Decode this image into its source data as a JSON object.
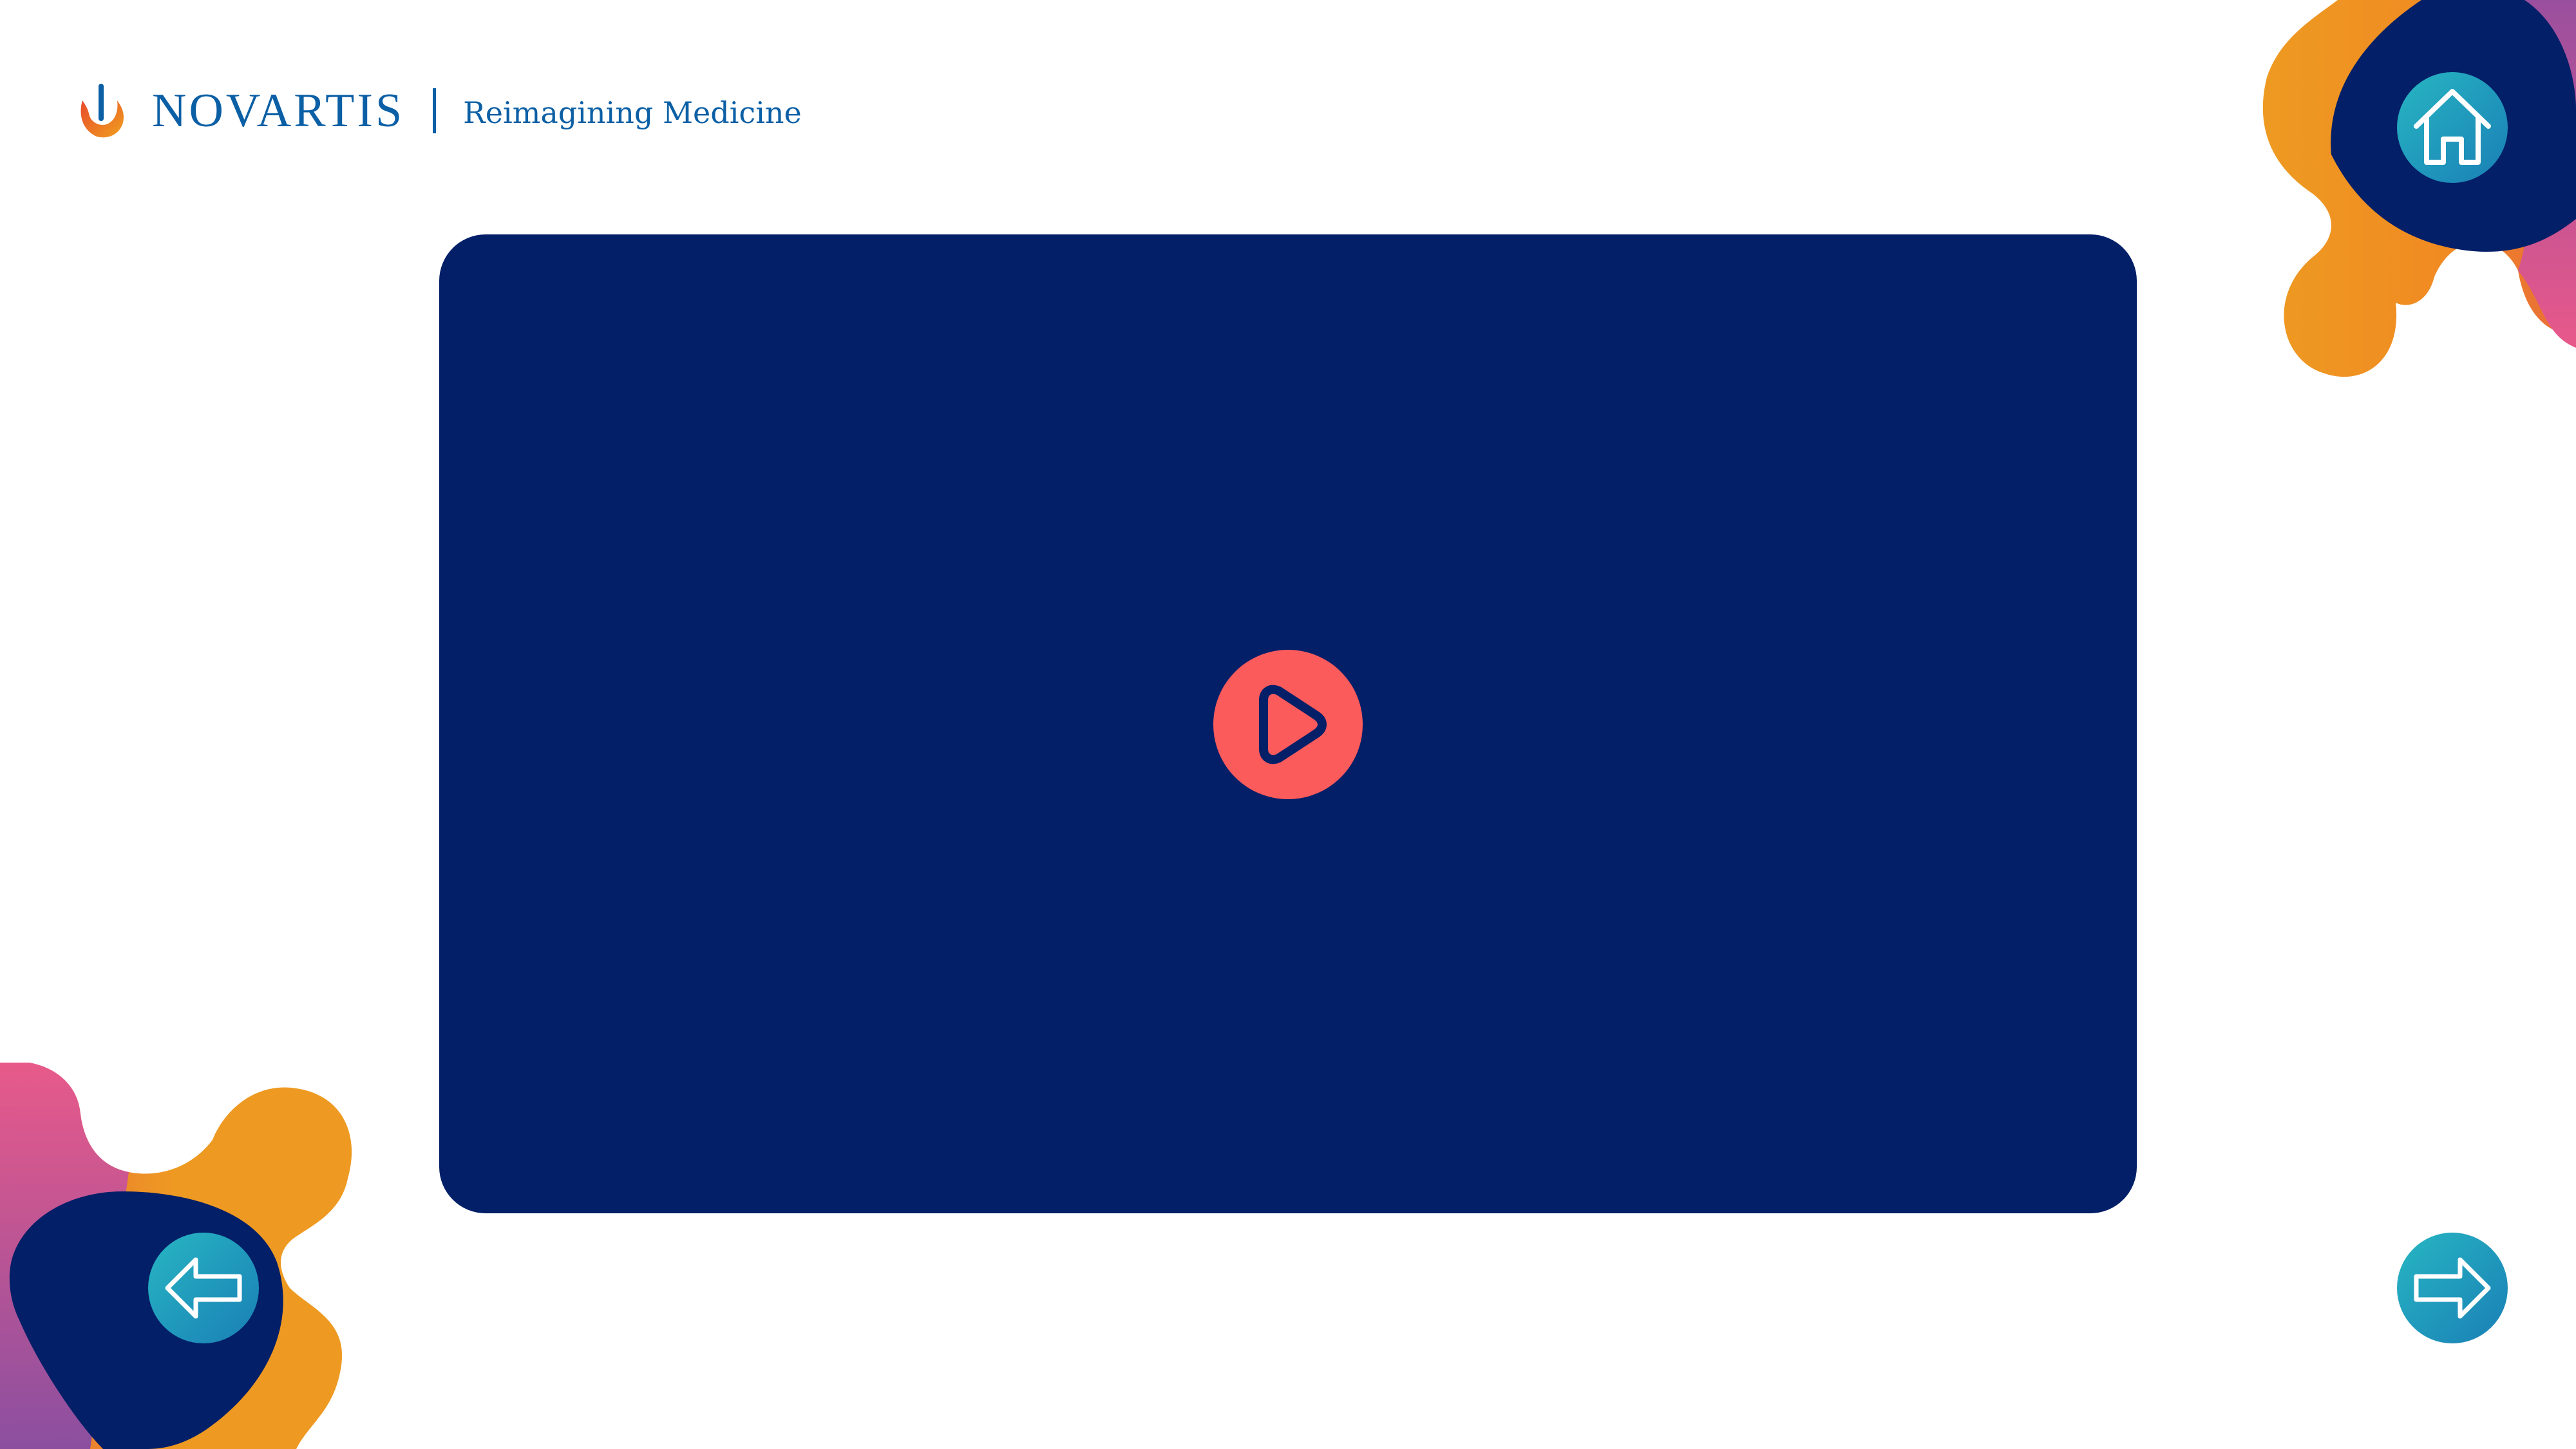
{
  "header": {
    "brand_name": "NOVARTIS",
    "tagline": "Reimagining Medicine"
  },
  "video": {
    "play_icon": "play-icon"
  },
  "navigation": {
    "home_icon": "home-icon",
    "prev_icon": "arrow-left-icon",
    "next_icon": "arrow-right-icon"
  },
  "colors": {
    "brand_blue": "#0b5fa5",
    "panel_navy": "#031f68",
    "play_coral": "#fc5b5b",
    "button_teal": "#27b6c2",
    "accent_orange": "#ee9a22",
    "accent_pink": "#e85a8a",
    "accent_purple": "#8b4fa0"
  }
}
